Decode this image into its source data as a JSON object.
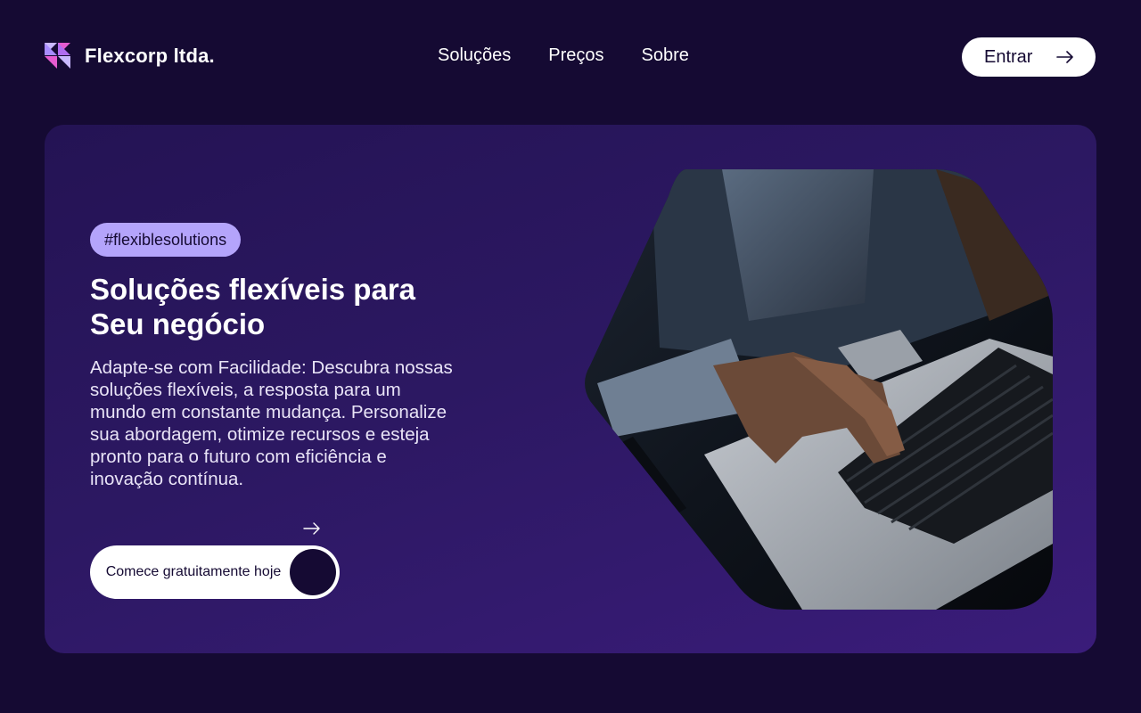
{
  "brand": {
    "name": "Flexcorp ltda.",
    "logo_icon": "flexcorp-logo-icon",
    "accent_color": "#b4a4fb",
    "background_color": "#150a33"
  },
  "nav": {
    "items": [
      {
        "label": "Soluções"
      },
      {
        "label": "Preços"
      },
      {
        "label": "Sobre"
      }
    ]
  },
  "header": {
    "login_label": "Entrar",
    "login_icon": "arrow-right-icon"
  },
  "hero": {
    "tag": "#flexiblesolutions",
    "title_line1": "Soluções flexíveis para",
    "title_line2": "Seu negócio",
    "description": "Adapte-se com Facilidade: Descubra nossas soluções flexíveis, a resposta para um mundo em constante mudança. Personalize sua abordagem, otimize recursos e esteja pronto para o futuro com eficiência e inovação contínua.",
    "cta_label": "Comece gratuitamente hoje",
    "cta_icon": "arrow-right-icon",
    "image_icon": "laptop-typing-photo"
  }
}
